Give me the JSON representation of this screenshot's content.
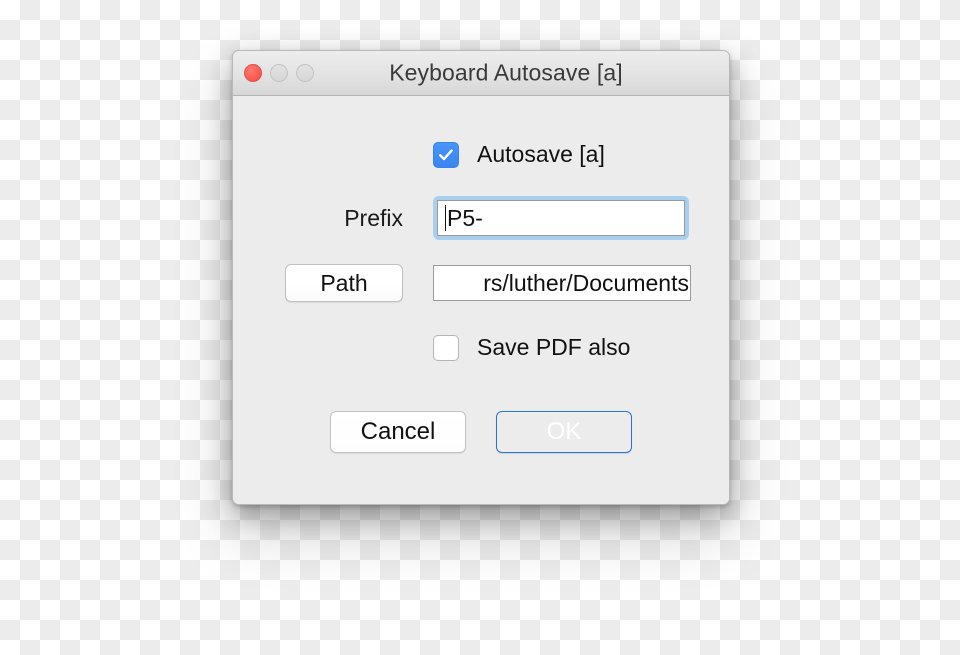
{
  "window": {
    "title": "Keyboard Autosave [a]",
    "traffic_lights": [
      {
        "name": "close",
        "state": "active",
        "color": "#fc5d55"
      },
      {
        "name": "minimize",
        "state": "disabled",
        "color": "#dcdcdc"
      },
      {
        "name": "zoom",
        "state": "disabled",
        "color": "#dcdcdc"
      }
    ]
  },
  "form": {
    "autosave": {
      "label": "Autosave [a]",
      "checked": true,
      "checkmark_color": "#ffffff",
      "box_color": "#3f8ef4"
    },
    "prefix": {
      "label": "Prefix",
      "value": "P5-",
      "focused": true,
      "focus_ring_color": "#a8cfee"
    },
    "path": {
      "button_label": "Path",
      "value": "rs/luther/Documents"
    },
    "save_pdf": {
      "label": "Save PDF also",
      "checked": false
    }
  },
  "buttons": {
    "cancel": "Cancel",
    "ok": "OK",
    "ok_color": "#3d8df1"
  }
}
